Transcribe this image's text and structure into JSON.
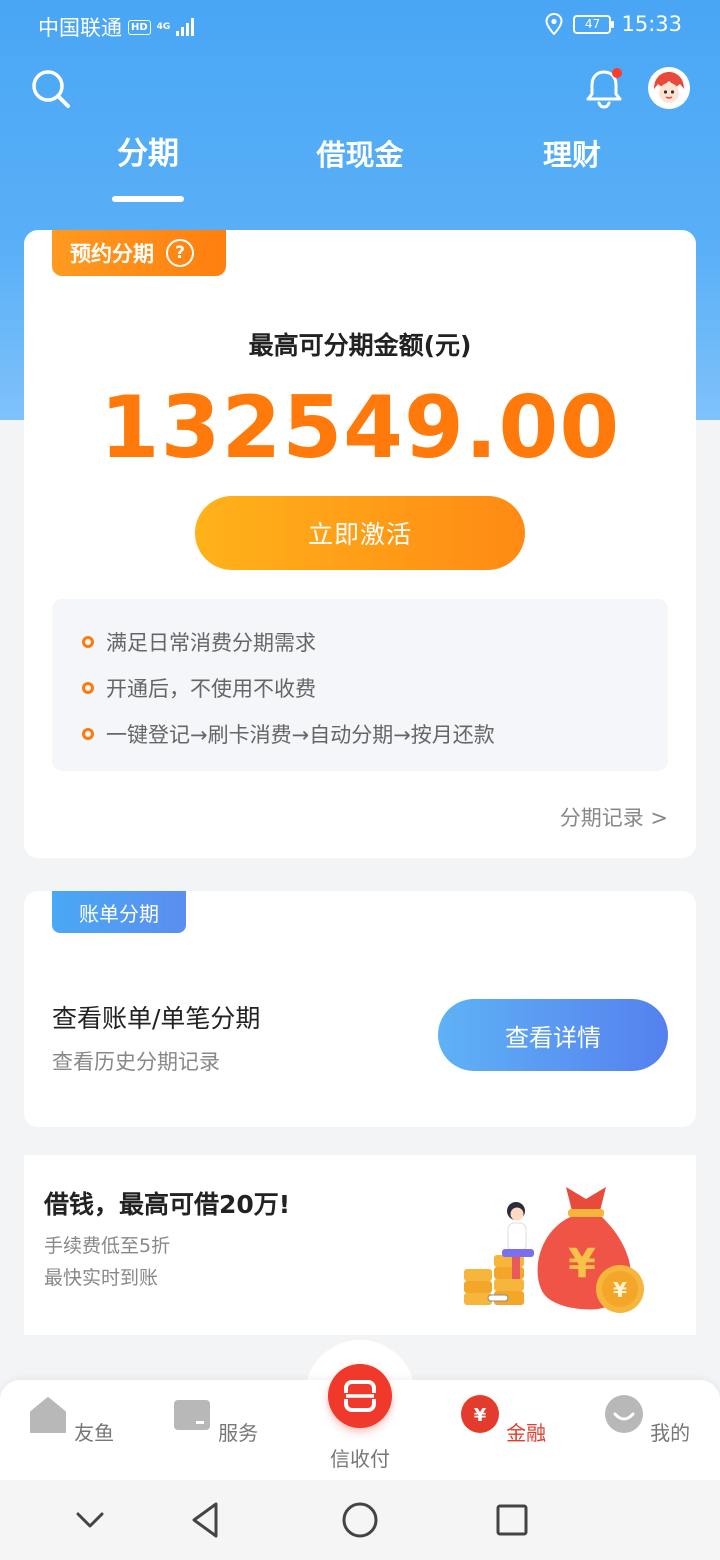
{
  "status": {
    "carrier": "中国联通",
    "hd": "HD",
    "network": "4G",
    "battery": "47",
    "time": "15:33"
  },
  "header": {
    "tabs": [
      {
        "label": "分期",
        "active": true
      },
      {
        "label": "借现金",
        "active": false
      },
      {
        "label": "理财",
        "active": false
      }
    ]
  },
  "installment_card": {
    "tag": "预约分期",
    "help": "?",
    "limit_label": "最高可分期金额(元)",
    "limit_amount": "132549.00",
    "activate_label": "立即激活",
    "features": [
      "满足日常消费分期需求",
      "开通后，不使用不收费",
      "一键登记→刷卡消费→自动分期→按月还款"
    ],
    "record_link": "分期记录 >"
  },
  "bill_card": {
    "tag": "账单分期",
    "title": "查看账单/单笔分期",
    "subtitle": "查看历史分期记录",
    "button": "查看详情"
  },
  "loan_banner": {
    "title": "借钱，最高可借20万!",
    "line1": "手续费低至5折",
    "line2": "最快实时到账"
  },
  "bottom_nav": [
    {
      "label": "友鱼",
      "icon": "home-icon",
      "active": false
    },
    {
      "label": "服务",
      "icon": "card-icon",
      "active": false
    },
    {
      "label": "信收付",
      "icon": "scan-icon",
      "active": false
    },
    {
      "label": "金融",
      "icon": "yen-icon",
      "active": true
    },
    {
      "label": "我的",
      "icon": "profile-icon",
      "active": false
    }
  ],
  "colors": {
    "accent_orange": "#ff7a0b",
    "brand_blue": "#49a6f5",
    "nav_active_red": "#e53b2c"
  }
}
